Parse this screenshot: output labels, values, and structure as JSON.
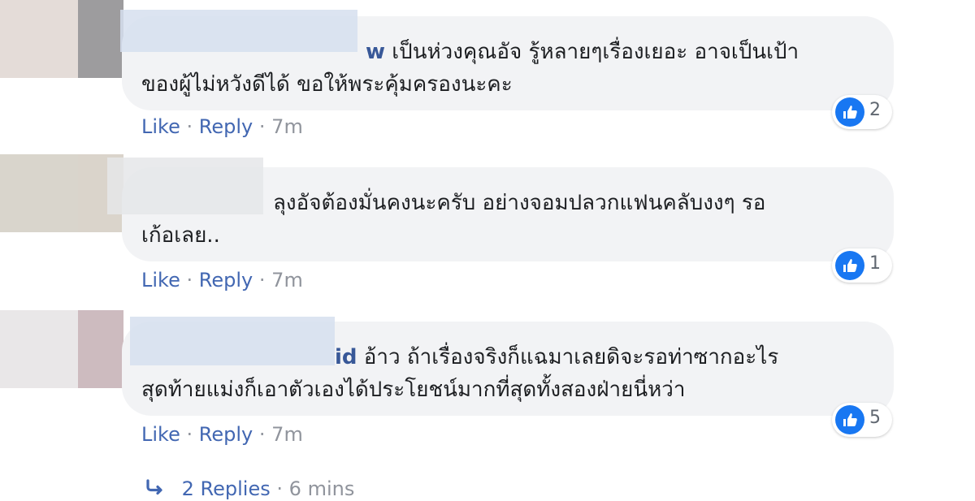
{
  "comments": [
    {
      "author_fragment": "w",
      "text": "เป็นห่วงคุณอัจ รู้หลายๆเรื่องเยอะ อาจเป็นเป้า\nของผู้ไม่หวังดีได้ ขอให้พระคุ้มครองนะคะ",
      "like_label": "Like",
      "reply_label": "Reply",
      "time": "7m",
      "reaction_count": "2"
    },
    {
      "author_fragment": "",
      "text": "ลุงอัจต้องมั่นคงนะครับ อย่างจอมปลวกแฟนคลับงงๆ รอ\nเก้อเลย..",
      "like_label": "Like",
      "reply_label": "Reply",
      "time": "7m",
      "reaction_count": "1"
    },
    {
      "author_fragment": "id",
      "text": "อ้าว ถ้าเรื่องจริงก็แฉมาเลยดิจะรอท่าซากอะไร\nสุดท้ายแม่งก็เอาตัวเองได้ประโยชน์มากที่สุดทั้งสองฝ่ายนี่หว่า",
      "like_label": "Like",
      "reply_label": "Reply",
      "time": "7m",
      "reaction_count": "5"
    }
  ],
  "replies_link": {
    "label": "2 Replies",
    "time": "6 mins"
  },
  "separator": "·",
  "colors": {
    "link": "#4267b2",
    "author": "#385898",
    "bubble": "#f2f3f5",
    "like_blue": "#1877f2",
    "meta_grey": "#90949c"
  },
  "icons": [
    "like-reaction-icon",
    "reply-arrow-icon"
  ]
}
